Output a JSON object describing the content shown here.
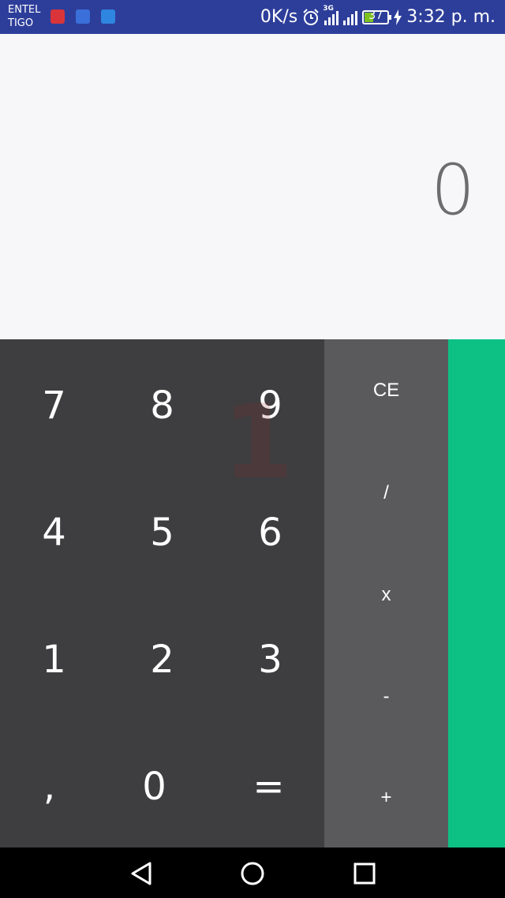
{
  "status_bar": {
    "carrier_line1": "ENTEL",
    "carrier_line2": "TIGO",
    "notification_icons": [
      "screen-recorder-icon",
      "data-transfer-icon",
      "usb-icon"
    ],
    "speed": "0K/s",
    "network_type": "3G",
    "battery_level": "37",
    "battery_fraction": 0.37,
    "time": "3:32 p. m."
  },
  "display": {
    "value": "0"
  },
  "keypad": {
    "rows": [
      [
        "7",
        "8",
        "9"
      ],
      [
        "4",
        "5",
        "6"
      ],
      [
        "1",
        "2",
        "3"
      ],
      [
        ",",
        "0",
        "="
      ]
    ]
  },
  "operators": [
    "CE",
    "/",
    "x",
    "-",
    "+"
  ],
  "ghost_digit": "1",
  "colors": {
    "status_bar": "#2d3e9a",
    "display_bg": "#f7f7f9",
    "numpad_bg": "#3e3e40",
    "operator_bg": "#5a5a5c",
    "accent_panel": "#0dc185",
    "nav_bar": "#000000"
  },
  "nav_bar": {
    "icons": [
      "back-icon",
      "home-icon",
      "recents-icon"
    ]
  }
}
